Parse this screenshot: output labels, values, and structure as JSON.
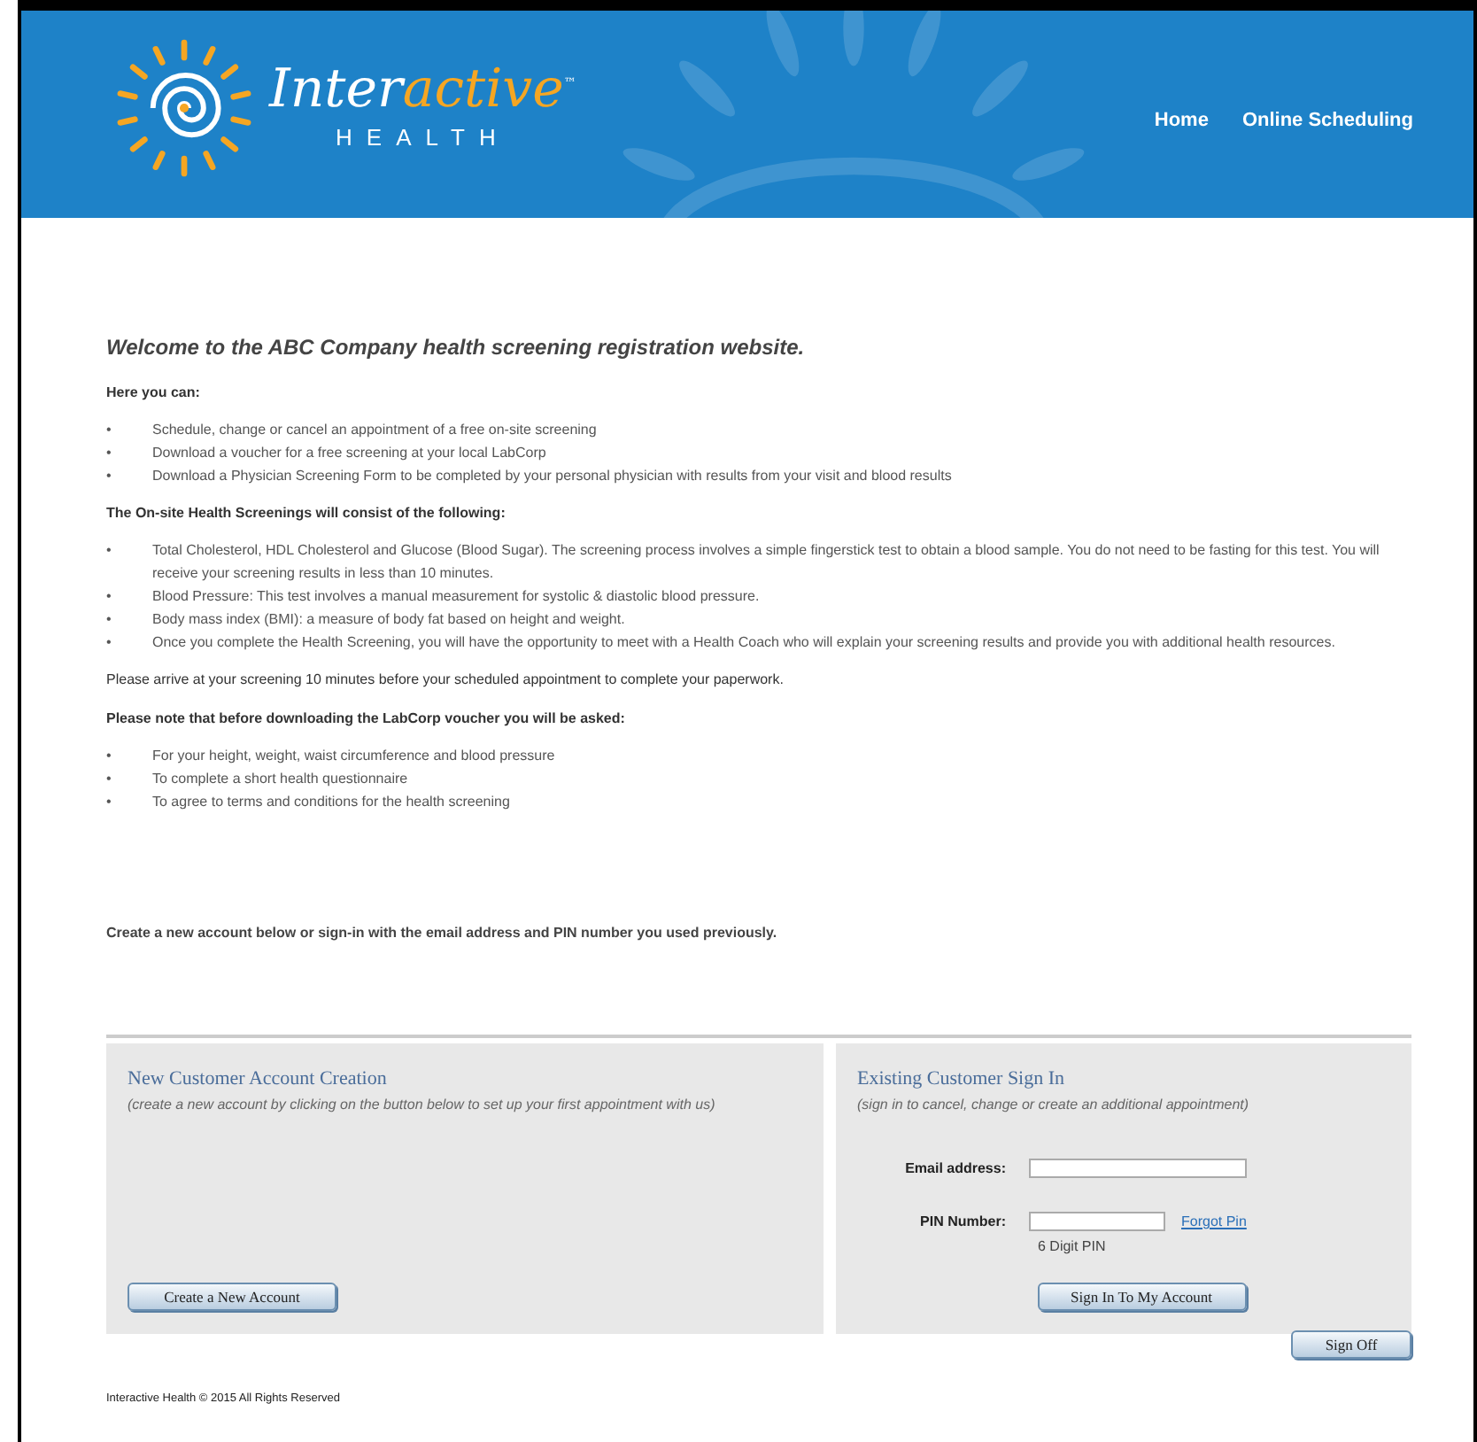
{
  "header": {
    "logo": {
      "word_start": "Inter",
      "word_end": "active",
      "trademark": "™",
      "subtitle": "HEALTH"
    },
    "nav": [
      {
        "label": "Home"
      },
      {
        "label": "Online Scheduling"
      }
    ]
  },
  "content": {
    "heading": "Welcome to the ABC Company health screening registration website.",
    "sections": [
      {
        "title": "Here you can:",
        "items": [
          "Schedule, change or cancel an appointment of a free on-site screening",
          "Download a voucher for a free screening at your local LabCorp",
          "Download a Physician Screening Form to be completed by your personal physician with results from your visit and blood results"
        ]
      },
      {
        "title": "The On-site Health Screenings will consist of the following:",
        "items": [
          "Total Cholesterol, HDL Cholesterol and Glucose (Blood Sugar). The screening process involves a simple fingerstick test to obtain a blood sample. You do not need to be fasting for this test. You will receive your screening results in less than 10 minutes.",
          "Blood Pressure: This test involves a manual measurement for systolic & diastolic blood pressure.",
          "Body mass index (BMI): a measure of body fat based on height and weight.",
          "Once you complete the Health Screening, you will have the opportunity to meet with a Health Coach who will explain your screening results and provide you with additional health resources."
        ],
        "note": "Please arrive at your screening 10 minutes before your scheduled appointment to complete your paperwork."
      },
      {
        "title": "Please note that before downloading the LabCorp voucher you will be asked:",
        "items": [
          "For your height, weight, waist circumference and blood pressure",
          "To complete a short health questionnaire",
          "To agree to terms and conditions for the health screening"
        ]
      }
    ],
    "bullet": "•",
    "prompt": "Create a new account below or sign-in with the email address and PIN number you used previously."
  },
  "new_account": {
    "title": "New Customer Account Creation",
    "subtitle": "(create a new account by clicking on the button below to set up your first appointment with us)",
    "button": "Create a New Account"
  },
  "sign_in": {
    "title": "Existing Customer Sign In",
    "subtitle": "(sign in to cancel, change or create an additional appointment)",
    "email_label": "Email address:",
    "pin_label": "PIN Number:",
    "forgot_link": "Forgot Pin",
    "pin_hint": "6 Digit PIN",
    "button": "Sign In To My Account"
  },
  "sign_off_button": "Sign Off",
  "footer": "Interactive Health © 2015 All Rights Reserved"
}
